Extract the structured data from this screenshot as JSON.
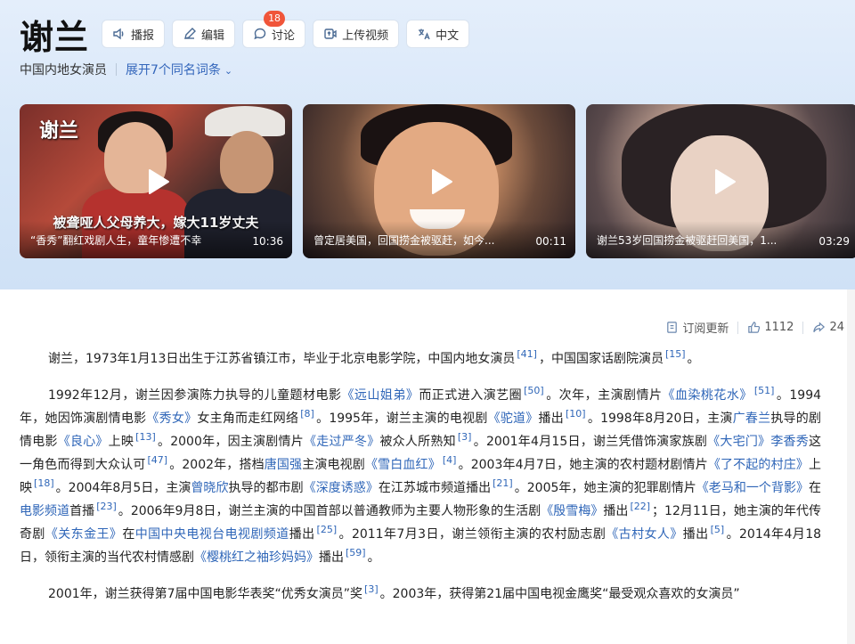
{
  "header": {
    "title": "谢兰",
    "buttons": [
      {
        "label": "播报",
        "icon": "speaker-icon"
      },
      {
        "label": "编辑",
        "icon": "pencil-icon"
      },
      {
        "label": "讨论",
        "icon": "comment-icon",
        "badge": "18"
      },
      {
        "label": "上传视频",
        "icon": "video-upload-icon"
      },
      {
        "label": "中文",
        "icon": "translate-icon"
      }
    ],
    "subtitle": "中国内地女演员",
    "expand_link": "展开7个同名词条"
  },
  "videos": [
    {
      "overlay_title": "谢兰",
      "banner": "被聋哑人父母养大，嫁大11岁丈夫",
      "caption": "“香秀”翻红戏剧人生，童年惨遭不幸",
      "duration": "10:36"
    },
    {
      "caption": "曾定居美国，回国捞金被驱赶，如今...",
      "duration": "00:11"
    },
    {
      "caption": "谢兰53岁回国捞金被驱赶回美国，1...",
      "duration": "03:29"
    }
  ],
  "meta": {
    "subscribe": "订阅更新",
    "likes": "1112",
    "shares": "24"
  },
  "content": {
    "p1": [
      {
        "t": "谢兰，1973年1月13日出生于江苏省镇江市，毕业于北京电影学院，中国内地女演员"
      },
      {
        "r": "[41]"
      },
      {
        "t": "，中国国家话剧院演员"
      },
      {
        "r": "[15]"
      },
      {
        "t": "。"
      }
    ],
    "p2": [
      {
        "t": "1992年12月，谢兰因参演陈力执导的儿童题材电影"
      },
      {
        "l": "《远山姐弟》"
      },
      {
        "t": "而正式进入演艺圈"
      },
      {
        "r": "[50]"
      },
      {
        "t": "。次年，主演剧情片"
      },
      {
        "l": "《血染桃花水》"
      },
      {
        "r": "[51]"
      },
      {
        "t": "。1994年，她因饰演剧情电影"
      },
      {
        "l": "《秀女》"
      },
      {
        "t": "女主角而走红网络"
      },
      {
        "r": "[8]"
      },
      {
        "t": "。1995年，谢兰主演的电视剧"
      },
      {
        "l": "《驼道》"
      },
      {
        "t": "播出"
      },
      {
        "r": "[10]"
      },
      {
        "t": "。1998年8月20日，主演"
      },
      {
        "l": "广春兰"
      },
      {
        "t": "执导的剧情电影"
      },
      {
        "l": "《良心》"
      },
      {
        "t": "上映"
      },
      {
        "r": "[13]"
      },
      {
        "t": "。2000年，因主演剧情片"
      },
      {
        "l": "《走过严冬》"
      },
      {
        "t": "被众人所熟知"
      },
      {
        "r": "[3]"
      },
      {
        "t": "。2001年4月15日，谢兰凭借饰演家族剧"
      },
      {
        "l": "《大宅门》"
      },
      {
        "l": "李香秀"
      },
      {
        "t": "这一角色而得到大众认可"
      },
      {
        "r": "[47]"
      },
      {
        "t": "。2002年，搭档"
      },
      {
        "l": "唐国强"
      },
      {
        "t": "主演电视剧"
      },
      {
        "l": "《雪白血红》"
      },
      {
        "r": "[4]"
      },
      {
        "t": "。2003年4月7日，她主演的农村题材剧情片"
      },
      {
        "l": "《了不起的村庄》"
      },
      {
        "t": "上映"
      },
      {
        "r": "[18]"
      },
      {
        "t": "。2004年8月5日，主演"
      },
      {
        "l": "曾晓欣"
      },
      {
        "t": "执导的都市剧"
      },
      {
        "l": "《深度诱惑》"
      },
      {
        "t": "在江苏城市频道播出"
      },
      {
        "r": "[21]"
      },
      {
        "t": "。2005年，她主演的犯罪剧情片"
      },
      {
        "l": "《老马和一个背影》"
      },
      {
        "t": "在"
      },
      {
        "l": "电影频道"
      },
      {
        "t": "首播"
      },
      {
        "r": "[23]"
      },
      {
        "t": "。2006年9月8日，谢兰主演的中国首部以普通教师为主要人物形象的生活剧"
      },
      {
        "l": "《殷雪梅》"
      },
      {
        "t": "播出"
      },
      {
        "r": "[22]"
      },
      {
        "t": "；12月11日，她主演的年代传奇剧"
      },
      {
        "l": "《关东金王》"
      },
      {
        "t": "在"
      },
      {
        "l": "中国中央电视台电视剧频道"
      },
      {
        "t": "播出"
      },
      {
        "r": "[25]"
      },
      {
        "t": "。2011年7月3日，谢兰领衔主演的农村励志剧"
      },
      {
        "l": "《古村女人》"
      },
      {
        "t": "播出"
      },
      {
        "r": "[5]"
      },
      {
        "t": "。2014年4月18日，领衔主演的当代农村情感剧"
      },
      {
        "l": "《樱桃红之袖珍妈妈》"
      },
      {
        "t": "播出"
      },
      {
        "r": "[59]"
      },
      {
        "t": "。"
      }
    ],
    "p3": [
      {
        "t": "2001年，谢兰获得第7届中国电影华表奖“优秀女演员”奖"
      },
      {
        "r": "[3]"
      },
      {
        "t": "。2003年，获得第21届中国电视金鹰奖“最受观众喜欢的女演员”"
      }
    ]
  }
}
